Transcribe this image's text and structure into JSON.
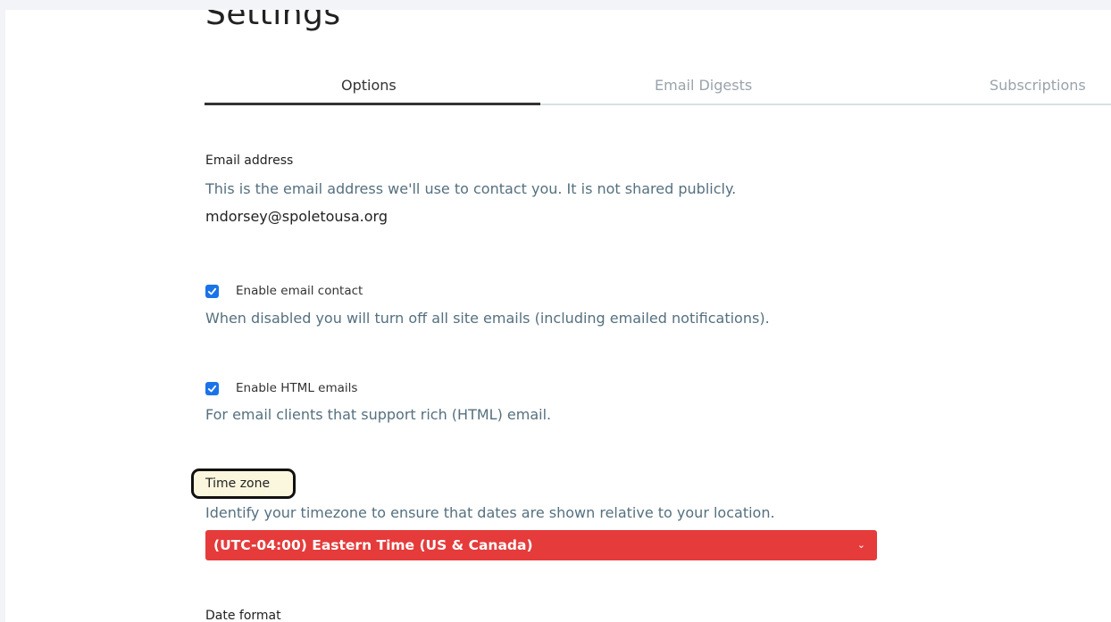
{
  "page": {
    "title": "Settings"
  },
  "tabs": [
    {
      "label": "Options",
      "active": true
    },
    {
      "label": "Email Digests",
      "active": false
    },
    {
      "label": "Subscriptions",
      "active": false
    }
  ],
  "email": {
    "label": "Email address",
    "description": "This is the email address we'll use to contact you. It is not shared publicly.",
    "value": "mdorsey@spoletousa.org"
  },
  "email_contact": {
    "checked": true,
    "label": "Enable email contact",
    "description": "When disabled you will turn off all site emails (including emailed notifications)."
  },
  "html_emails": {
    "checked": true,
    "label": "Enable HTML emails",
    "description": "For email clients that support rich (HTML) email."
  },
  "timezone": {
    "label": "Time zone",
    "description": "Identify your timezone to ensure that dates are shown relative to your location.",
    "selected": "(UTC-04:00) Eastern Time (US & Canada)"
  },
  "date_format": {
    "label": "Date format"
  },
  "colors": {
    "checkbox": "#1a73e8",
    "select_bg": "#e53b3b",
    "highlight_border": "#111111",
    "highlight_bg": "#fbf7de"
  },
  "icons": {
    "checkbox": "checkmark-icon",
    "select": "chevron-down-icon"
  }
}
